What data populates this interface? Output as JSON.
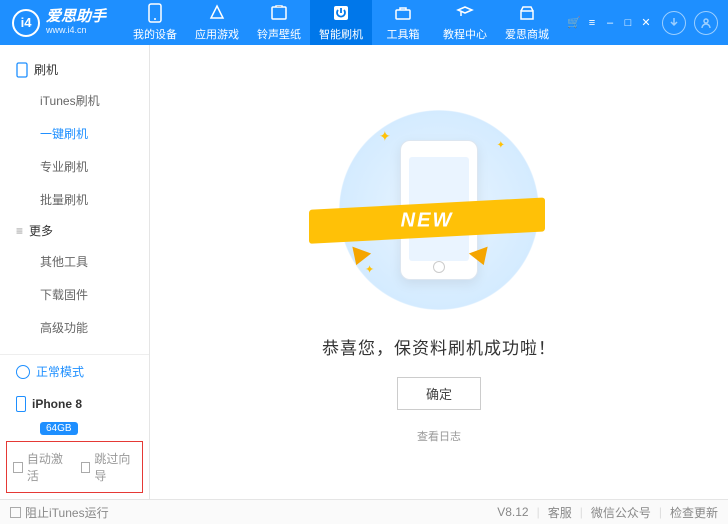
{
  "brand": {
    "name": "爱思助手",
    "url": "www.i4.cn",
    "logo_short": "i4"
  },
  "nav": [
    {
      "icon": "device-icon",
      "label": "我的设备"
    },
    {
      "icon": "apps-icon",
      "label": "应用游戏"
    },
    {
      "icon": "ringtone-icon",
      "label": "铃声壁纸"
    },
    {
      "icon": "flash-icon",
      "label": "智能刷机",
      "active": true
    },
    {
      "icon": "toolbox-icon",
      "label": "工具箱"
    },
    {
      "icon": "tutorial-icon",
      "label": "教程中心"
    },
    {
      "icon": "store-icon",
      "label": "爱思商城"
    }
  ],
  "sidebar": {
    "group1": {
      "title": "刷机",
      "items": [
        "iTunes刷机",
        "一键刷机",
        "专业刷机",
        "批量刷机"
      ],
      "activeIndex": 1
    },
    "group2": {
      "title": "更多",
      "items": [
        "其他工具",
        "下载固件",
        "高级功能"
      ]
    }
  },
  "mode": {
    "label": "正常模式"
  },
  "device": {
    "name": "iPhone 8",
    "capacity": "64GB"
  },
  "checks": {
    "auto_activate": "自动激活",
    "skip_guide": "跳过向导"
  },
  "main": {
    "ribbon_text": "NEW",
    "success_msg": "恭喜您，保资料刷机成功啦！",
    "ok_btn": "确定",
    "log_link": "查看日志"
  },
  "status": {
    "block_itunes": "阻止iTunes运行",
    "version": "V8.12",
    "support": "客服",
    "wechat": "微信公众号",
    "update": "检查更新"
  }
}
